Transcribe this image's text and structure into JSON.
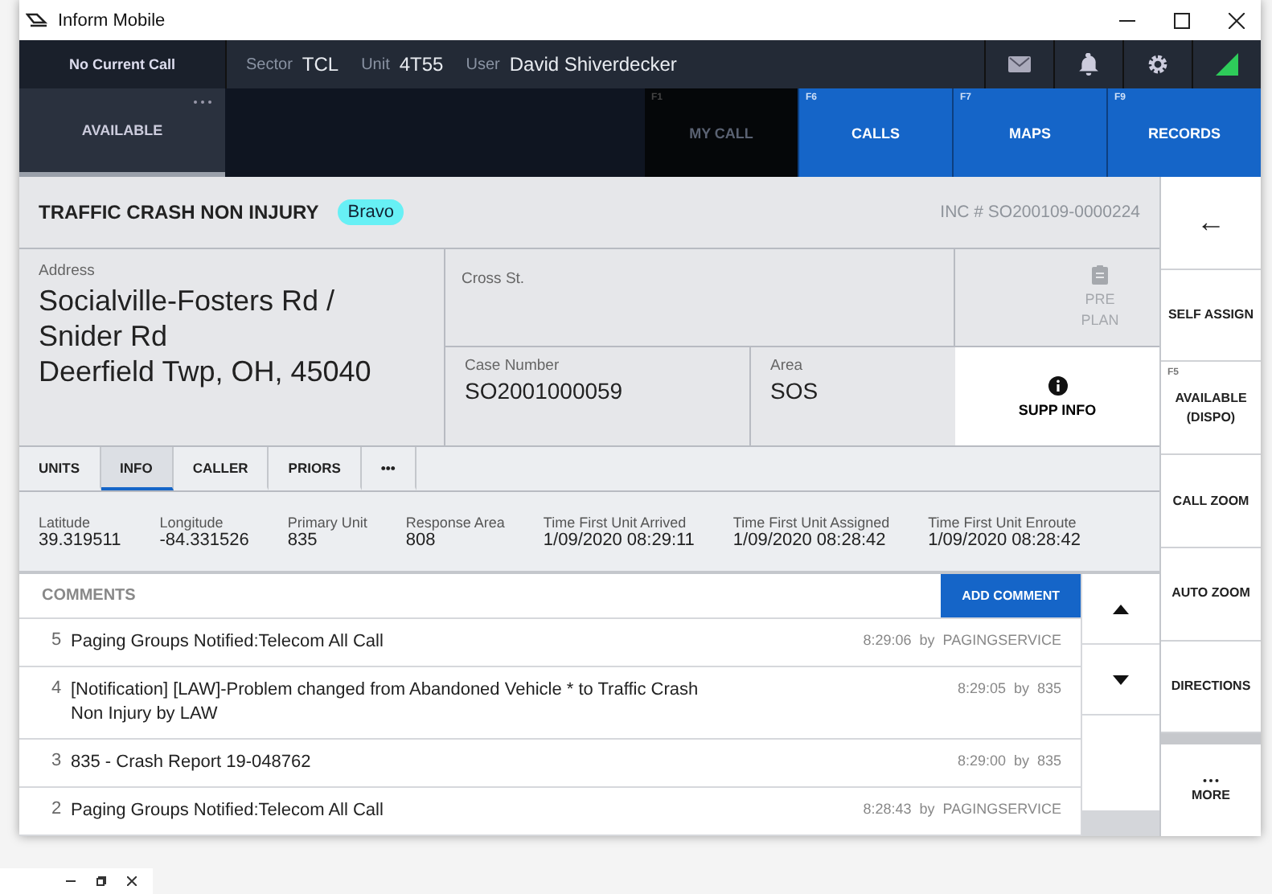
{
  "window": {
    "title": "Inform Mobile"
  },
  "header": {
    "current_call": "No Current Call",
    "fields": [
      {
        "label": "Sector",
        "value": "TCL"
      },
      {
        "label": "Unit",
        "value": "4T55"
      },
      {
        "label": "User",
        "value": "David Shiverdecker"
      }
    ]
  },
  "nav_tabs": [
    {
      "kind": "status",
      "label": "AVAILABLE",
      "selected": true,
      "disabled": false
    },
    {
      "kind": "key",
      "label": "MY CALL",
      "fkey": "F1",
      "selected": false,
      "disabled": true
    },
    {
      "kind": "key",
      "label": "CALLS",
      "fkey": "F6",
      "selected": false,
      "disabled": false
    },
    {
      "kind": "key",
      "label": "MAPS",
      "fkey": "F7",
      "selected": false,
      "disabled": false
    },
    {
      "kind": "key",
      "label": "RECORDS",
      "fkey": "F9",
      "selected": false,
      "disabled": false
    }
  ],
  "incident": {
    "title": "TRAFFIC CRASH NON INJURY",
    "tag": "Bravo",
    "inc_number": "INC # SO200109-0000224",
    "address_label": "Address",
    "address_lines": [
      "Socialville-Fosters Rd /",
      "Snider Rd",
      "Deerfield Twp, OH, 45040"
    ],
    "cross_label": "Cross St.",
    "preplan": {
      "label": "PRE PLAN",
      "disabled": true
    },
    "case_label": "Case Number",
    "case_value": "SO2001000059",
    "area_label": "Area",
    "area_value": "SOS",
    "supp_info": "SUPP INFO"
  },
  "detail_tabs": [
    {
      "label": "UNITS",
      "selected": false
    },
    {
      "label": "INFO",
      "selected": true
    },
    {
      "label": "CALLER",
      "selected": false
    },
    {
      "label": "PRIORS",
      "selected": false
    },
    {
      "label": "•••",
      "selected": false
    }
  ],
  "info_fields": [
    {
      "label": "Latitude",
      "value": "39.319511"
    },
    {
      "label": "Longitude",
      "value": "-84.331526"
    },
    {
      "label": "Primary Unit",
      "value": "835"
    },
    {
      "label": "Response Area",
      "value": "808"
    },
    {
      "label": "Time First Unit Arrived",
      "value": "1/09/2020 08:29:11"
    },
    {
      "label": "Time First Unit Assigned",
      "value": "1/09/2020 08:28:42"
    },
    {
      "label": "Time First Unit Enroute",
      "value": "1/09/2020 08:28:42"
    }
  ],
  "comments": {
    "title": "COMMENTS",
    "add_button": "ADD COMMENT",
    "rows": [
      {
        "num": "5",
        "text": "Paging Groups Notified:Telecom All Call",
        "meta": "8:29:06  by  PAGINGSERVICE"
      },
      {
        "num": "4",
        "text": "[Notification] [LAW]-Problem changed from Abandoned Vehicle * to Traffic Crash Non Injury by LAW",
        "meta": "8:29:05  by  835"
      },
      {
        "num": "3",
        "text": "835 - Crash Report 19-048762",
        "meta": "8:29:00  by  835"
      },
      {
        "num": "2",
        "text": "Paging Groups Notified:Telecom All Call",
        "meta": "8:28:43  by  PAGINGSERVICE"
      }
    ]
  },
  "sidebar": [
    {
      "kind": "back",
      "label": "←"
    },
    {
      "kind": "button",
      "label": "SELF ASSIGN"
    },
    {
      "kind": "button",
      "label": "AVAILABLE (DISPO)",
      "fkey": "F5"
    },
    {
      "kind": "button",
      "label": "CALL ZOOM"
    },
    {
      "kind": "button",
      "label": "AUTO ZOOM"
    },
    {
      "kind": "button",
      "label": "DIRECTIONS"
    },
    {
      "kind": "more",
      "label": "MORE"
    }
  ]
}
